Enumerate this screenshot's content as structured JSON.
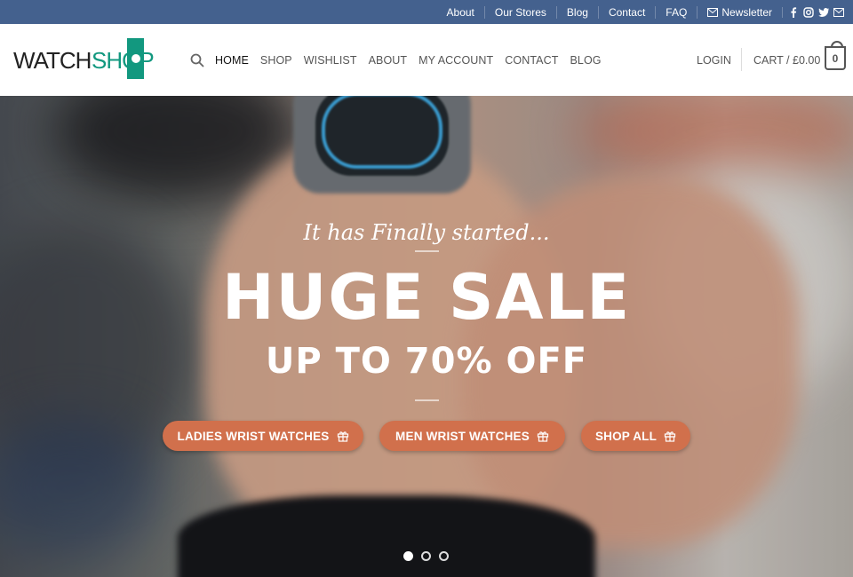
{
  "topbar": {
    "links": [
      "About",
      "Our Stores",
      "Blog",
      "Contact",
      "FAQ"
    ],
    "newsletter": "Newsletter",
    "social_icons": [
      "facebook-icon",
      "instagram-icon",
      "twitter-icon",
      "email-icon"
    ]
  },
  "header": {
    "logo_part1": "WATCH",
    "logo_part2": "SHOP",
    "nav": [
      "HOME",
      "SHOP",
      "WISHLIST",
      "ABOUT",
      "MY ACCOUNT",
      "CONTACT",
      "BLOG"
    ],
    "active_nav": "HOME",
    "login": "LOGIN",
    "cart_label": "CART / £0.00",
    "cart_count": "0"
  },
  "hero": {
    "tagline": "It has Finally started...",
    "headline": "HUGE SALE",
    "subheadline": "UP TO 70% OFF",
    "buttons": [
      "LADIES WRIST WATCHES",
      "MEN WRIST WATCHES",
      "SHOP ALL"
    ],
    "slides_total": 3,
    "active_slide": 1
  },
  "colors": {
    "topbar_bg": "#44618e",
    "brand_green": "#12987f",
    "button_orange": "#d1704c"
  }
}
